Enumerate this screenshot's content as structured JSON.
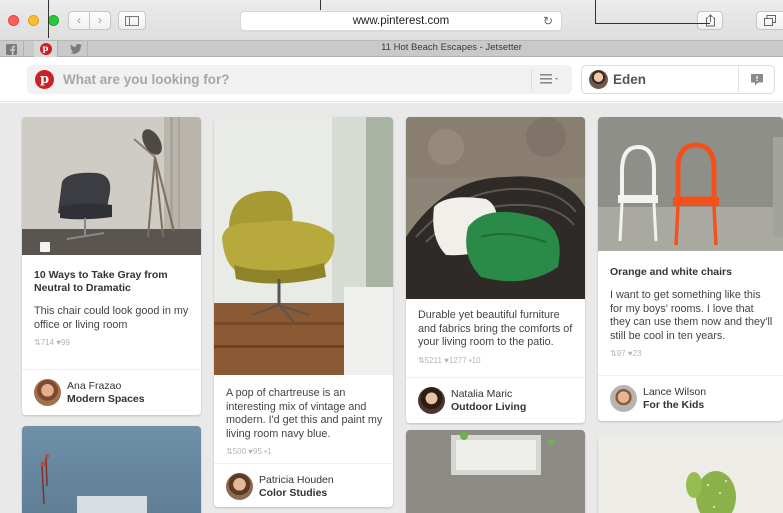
{
  "browser": {
    "url": "www.pinterest.com",
    "tab_title": "11 Hot Beach Escapes - Jetsetter",
    "pinned_tabs": [
      {
        "icon": "facebook-icon",
        "color": "#3b5998"
      },
      {
        "icon": "pinterest-icon",
        "color": "#cb2027"
      },
      {
        "icon": "twitter-icon",
        "color": "#55acee"
      }
    ]
  },
  "header": {
    "search_placeholder": "What are you looking for?",
    "user_name": "Eden",
    "accent": "#cb2027"
  },
  "pins": [
    {
      "title": "10 Ways to Take Gray from Neutral to Dramatic",
      "description": "This chair could look good in my office or living room",
      "stats": "⇅714 ♥99",
      "user": "Ana Frazao",
      "board": "Modern Spaces"
    },
    {
      "title": "",
      "description": "A pop of chartreuse is an interesting mix of vintage and modern. I'd get this and paint my living room navy blue.",
      "stats": "⇅500 ♥95 ▪1",
      "user": "Patricia Houden",
      "board": "Color Studies"
    },
    {
      "title": "",
      "description": "Durable yet beautiful furniture and fabrics bring the comforts of your living room to the patio.",
      "stats": "⇅5211 ♥1277 ▪10",
      "user": "Natalia Maric",
      "board": "Outdoor Living"
    },
    {
      "title": "Orange and white chairs",
      "description": "I want to get something like this for my boys' rooms. I love that they can use them now and they'll still be cool in ten years.",
      "stats": "⇅97 ♥23",
      "user": "Lance Wilson",
      "board": "For the Kids"
    }
  ]
}
